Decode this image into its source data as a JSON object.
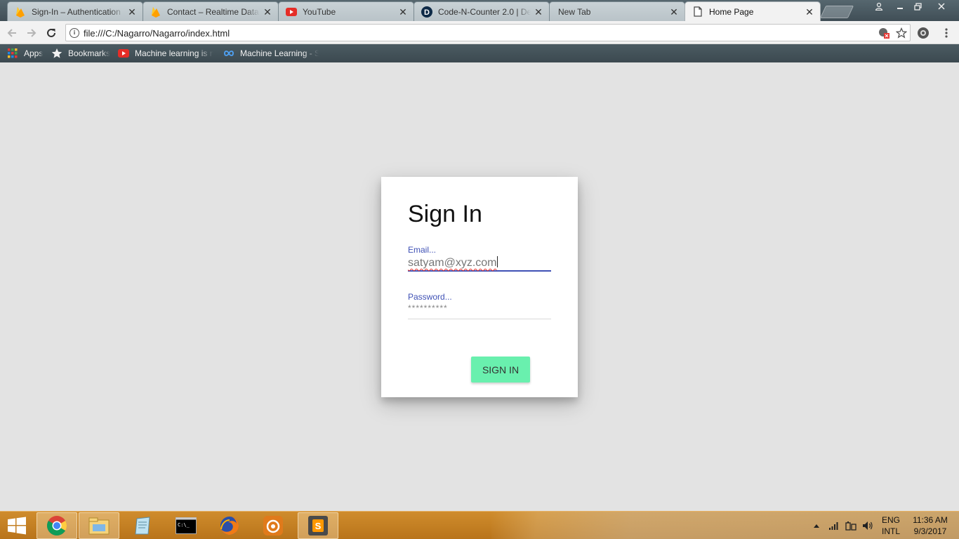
{
  "browser": {
    "tabs": [
      {
        "title": "Sign-In – Authentication",
        "icon": "firebase-icon",
        "active": false
      },
      {
        "title": "Contact – Realtime Datab",
        "icon": "firebase-icon",
        "active": false
      },
      {
        "title": "YouTube",
        "icon": "youtube-icon",
        "active": false
      },
      {
        "title": "Code-N-Counter 2.0 | De",
        "icon": "d-logo-icon",
        "active": false
      },
      {
        "title": "New Tab",
        "icon": "",
        "active": false
      },
      {
        "title": "Home Page",
        "icon": "page-icon",
        "active": true
      }
    ],
    "close_glyph": "✕",
    "address_bar": {
      "url": "file:///C:/Nagarro/Nagarro/index.html"
    },
    "bookmarks": [
      {
        "label": "Apps",
        "icon": "apps-grid-icon"
      },
      {
        "label": "Bookmarks",
        "icon": "star-icon"
      },
      {
        "label": "Machine learning is n",
        "icon": "youtube-icon"
      },
      {
        "label": "Machine Learning - S",
        "icon": "infinity-icon"
      }
    ]
  },
  "signin": {
    "title": "Sign In",
    "email_label": "Email...",
    "email_value": "satyam@xyz.com",
    "password_label": "Password...",
    "password_value": "**********",
    "button_label": "SIGN IN"
  },
  "taskbar": {
    "apps": [
      "chrome-icon",
      "file-explorer-icon",
      "notepad-icon",
      "command-prompt-icon",
      "firefox-icon",
      "app-icon",
      "sublime-text-icon"
    ],
    "language": {
      "line1": "ENG",
      "line2": "INTL"
    },
    "clock": {
      "time": "11:36 AM",
      "date": "9/3/2017"
    }
  },
  "colors": {
    "accent": "#3f51b5",
    "button": "#69f0ae",
    "page_bg": "#e3e3e3",
    "taskbar": "#c57f24"
  }
}
